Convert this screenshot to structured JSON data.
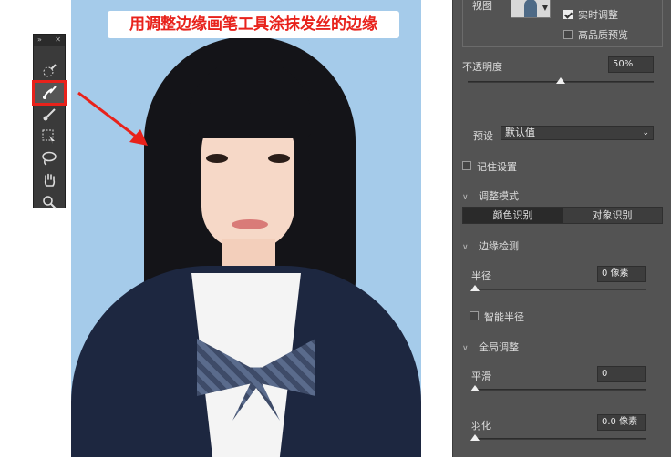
{
  "banner": {
    "text": "用调整边缘画笔工具涂抹发丝的边缘"
  },
  "colors": {
    "annotation_red": "#e8221b",
    "panel_bg": "#535353",
    "photo_bg": "#a5cbea"
  },
  "tools": [
    {
      "icon": "quick-selection-icon"
    },
    {
      "icon": "refine-edge-brush-icon",
      "active": true
    },
    {
      "icon": "brush-icon"
    },
    {
      "icon": "object-selection-icon"
    },
    {
      "icon": "lasso-icon"
    },
    {
      "icon": "hand-icon"
    },
    {
      "icon": "zoom-icon"
    }
  ],
  "properties": {
    "view_label": "视图",
    "realtime_label": "实时调整",
    "realtime_checked": true,
    "hq_preview_label": "高品质预览",
    "hq_preview_checked": false,
    "opacity_label": "不透明度",
    "opacity_value": "50%",
    "opacity_fraction": 0.5,
    "preset_label": "预设",
    "preset_value": "默认值",
    "remember_label": "记住设置",
    "remember_checked": false,
    "adjust_mode_section": "调整模式",
    "mode_color": "颜色识别",
    "mode_object": "对象识别",
    "edge_detection_section": "边缘检测",
    "radius_label": "半径",
    "radius_value": "0 像素",
    "smart_radius_label": "智能半径",
    "smart_radius_checked": false,
    "global_section": "全局调整",
    "smooth_label": "平滑",
    "smooth_value": "0",
    "feather_label": "羽化",
    "feather_value": "0.0 像素"
  }
}
